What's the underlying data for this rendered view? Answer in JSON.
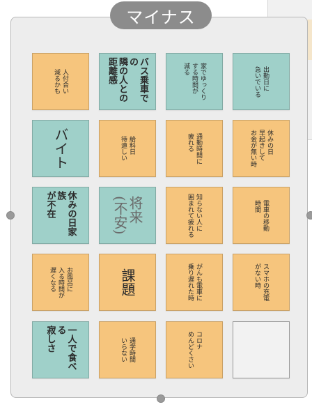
{
  "board": {
    "title": "マイナス"
  },
  "colors": {
    "orange": "#f6c57d",
    "teal": "#9fd0c9",
    "frame": "#ededed",
    "title_pill": "#8c8c8c"
  },
  "notes": [
    {
      "text": "人付合い\n減るかも",
      "color": "orange"
    },
    {
      "text": "バス乗車での\n隣の人との\n距離感",
      "color": "teal"
    },
    {
      "text": "家でゆっくり\nする時間が\n減る",
      "color": "teal"
    },
    {
      "text": "出勤日に\n急いでいる",
      "color": "teal"
    },
    {
      "text": "バイト",
      "color": "teal"
    },
    {
      "text": "給料日\n待遠しい",
      "color": "orange"
    },
    {
      "text": "通勤時間に\n疲れる",
      "color": "orange"
    },
    {
      "text": "休みの日\n早起きして\nお金が無い時",
      "color": "orange"
    },
    {
      "text": "休みの日家族\nが不在",
      "color": "teal"
    },
    {
      "text": "将来\n(不安)",
      "color": "teal"
    },
    {
      "text": "知らない人に\n囲まれて疲れる",
      "color": "orange"
    },
    {
      "text": "電車の移動\n時間",
      "color": "orange"
    },
    {
      "text": "お風呂に\n入る時間が\n遅くなる",
      "color": "orange"
    },
    {
      "text": "課題",
      "color": "orange"
    },
    {
      "text": "がんも電車に\n乗り遅れた時",
      "color": "orange"
    },
    {
      "text": "スマホの充電\nがない時",
      "color": "orange"
    },
    {
      "text": "一人で食べる\n寂しさ",
      "color": "teal"
    },
    {
      "text": "通学時間\nいらない",
      "color": "orange"
    },
    {
      "text": "コロナ\nめんどくさい",
      "color": "orange"
    },
    {
      "text": "",
      "color": "empty"
    }
  ]
}
